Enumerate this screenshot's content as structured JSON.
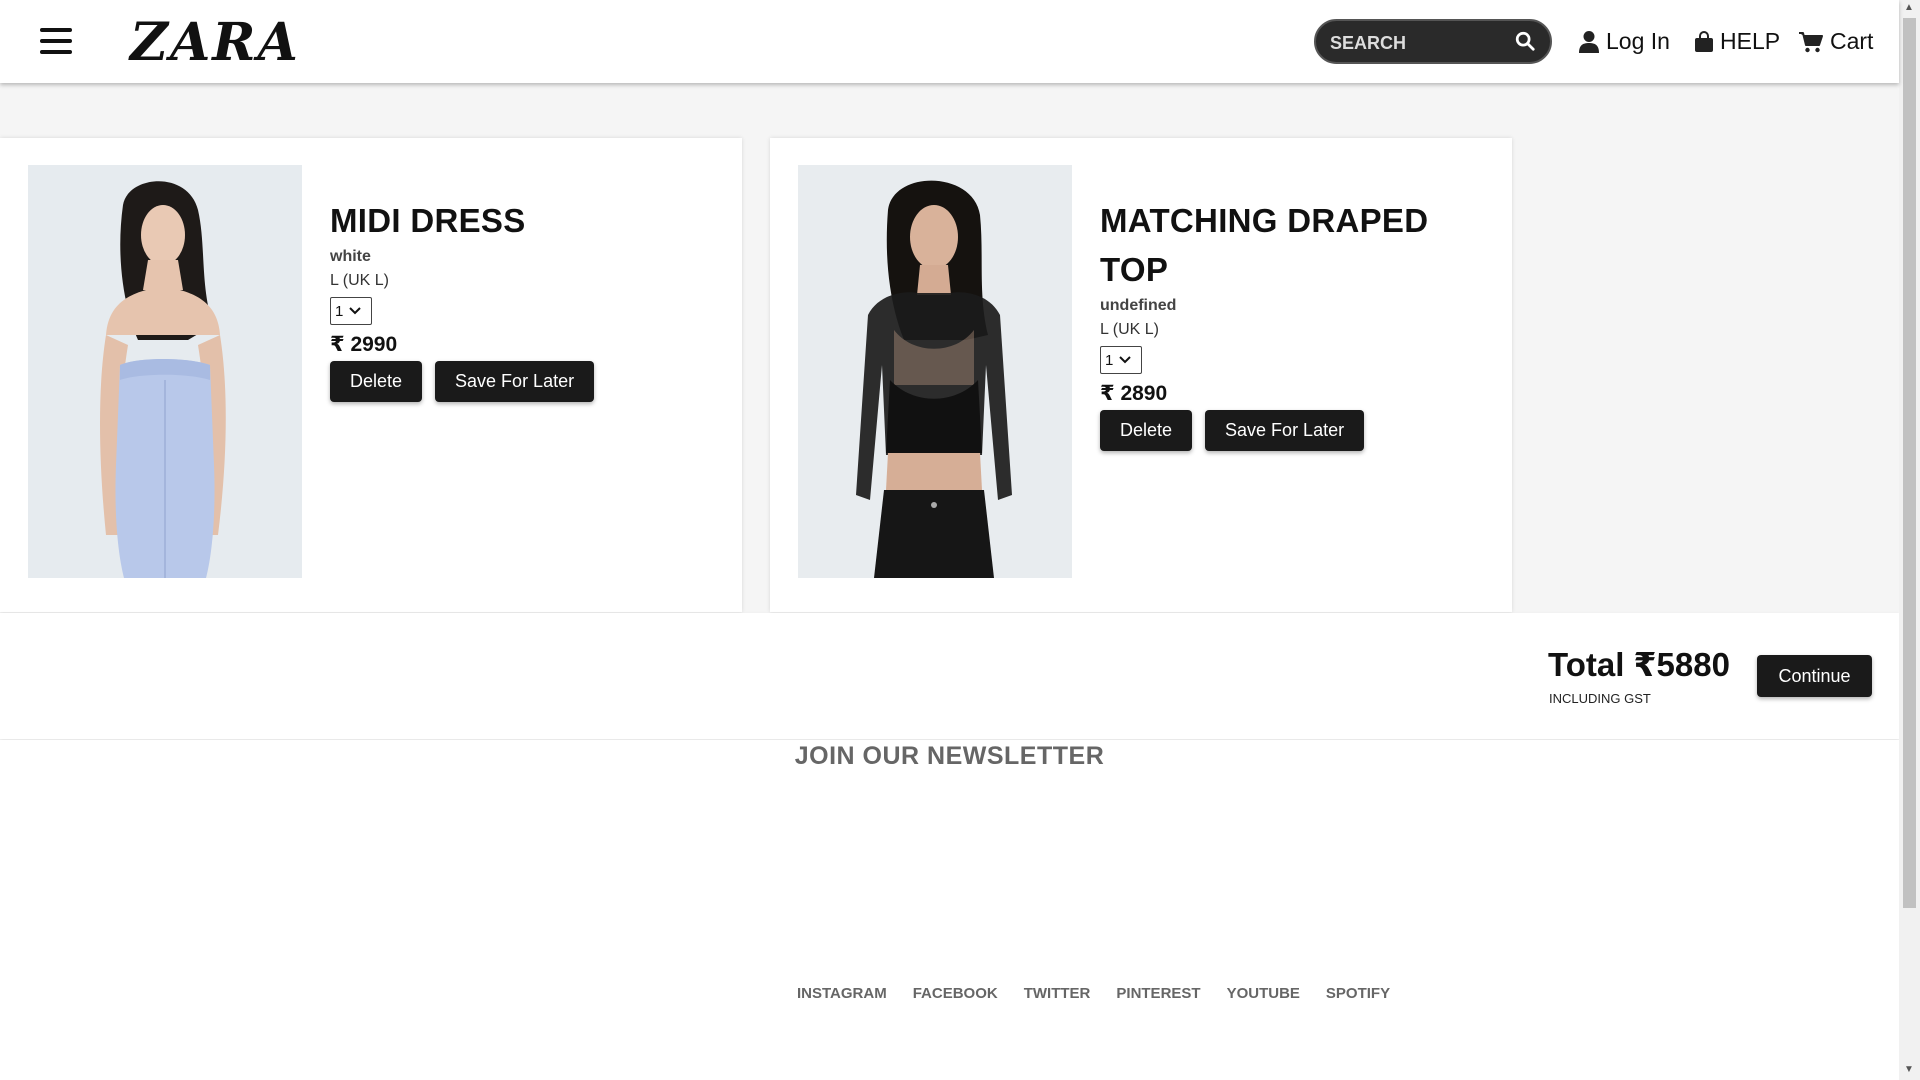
{
  "header": {
    "logo": "ZARA",
    "search_placeholder": "SEARCH",
    "login_label": "Log In",
    "help_label": "HELP",
    "cart_label": "Cart"
  },
  "cart_items": [
    {
      "title": "MIDI DRESS",
      "color": "white",
      "size": "L (UK L)",
      "quantity": "1",
      "price": "₹ 2990",
      "delete_label": "Delete",
      "save_label": "Save For Later"
    },
    {
      "title": "MATCHING DRAPED TOP",
      "color": "undefined",
      "size": "L (UK L)",
      "quantity": "1",
      "price": "₹ 2890",
      "delete_label": "Delete",
      "save_label": "Save For Later"
    }
  ],
  "summary": {
    "total": "Total ₹5880",
    "gst_note": "INCLUDING GST",
    "continue_label": "Continue"
  },
  "footer": {
    "newsletter": "JOIN OUR NEWSLETTER",
    "social": [
      "INSTAGRAM",
      "FACEBOOK",
      "TWITTER",
      "PINTEREST",
      "YOUTUBE",
      "SPOTIFY"
    ]
  },
  "colors": {
    "button_bg": "#1a1a1a",
    "search_bg": "#2a2a2a",
    "muted_text": "#666666"
  }
}
